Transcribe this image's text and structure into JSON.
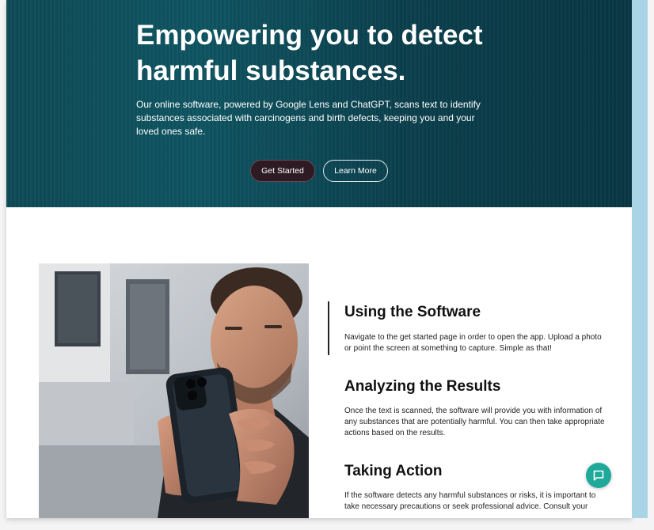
{
  "hero": {
    "title": "Empowering you to detect harmful substances.",
    "description": "Our online software, powered by Google Lens and ChatGPT, scans text to identify substances associated with carcinogens and birth defects, keeping you and your loved ones safe.",
    "primary_button": "Get Started",
    "secondary_button": "Learn More"
  },
  "sections": [
    {
      "title": "Using the Software",
      "text": "Navigate to the get started page in order to open the app. Upload a photo or point the screen at something to capture. Simple as that!"
    },
    {
      "title": "Analyzing the Results",
      "text": "Once the text is scanned, the software will provide you with information of any substances that are potentially harmful. You can then take appropriate actions based on the results."
    },
    {
      "title": "Taking Action",
      "text": "If the software detects any harmful substances or risks, it is important to take necessary precautions or seek professional advice. Consult your"
    }
  ],
  "chat": {
    "icon": "chat-icon"
  },
  "colors": {
    "hero_bg": "#0d4a56",
    "primary_button_bg": "#2d1a22",
    "chat_accent": "#1fa99a",
    "scroll_rail": "#a9d4e6"
  }
}
